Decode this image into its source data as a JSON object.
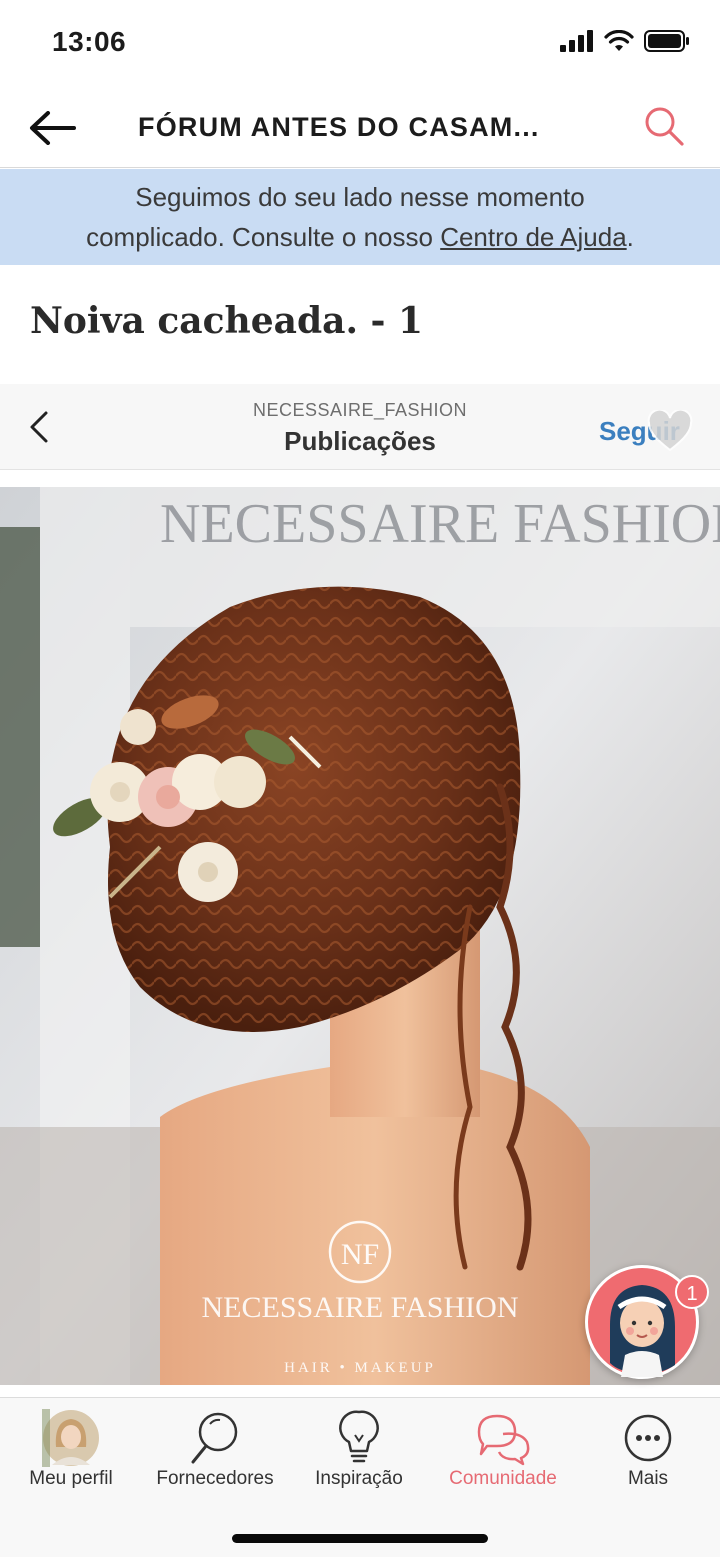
{
  "status_bar": {
    "time": "13:06"
  },
  "header": {
    "title": "FÓRUM ANTES DO CASAM..."
  },
  "banner": {
    "line1": "Seguimos do seu lado nesse momento",
    "line2_prefix": "complicado. Consulte o nosso ",
    "link": "Centro de Ajuda",
    "line2_suffix": "."
  },
  "post": {
    "title": "Noiva cacheada. - 1"
  },
  "embed": {
    "username": "NECESSAIRE_FASHION",
    "section": "Publicações",
    "follow_label": "Seguir"
  },
  "photo": {
    "sign_text": "NECESSAIRE FASHION",
    "logo_initials": "NF",
    "watermark_brand": "NECESSAIRE FASHION",
    "watermark_sub": "HAIR • MAKEUP"
  },
  "chat_badge": {
    "count": "1"
  },
  "tabbar": {
    "items": [
      {
        "label": "Meu perfil",
        "icon": "profile-avatar"
      },
      {
        "label": "Fornecedores",
        "icon": "magnifier-icon"
      },
      {
        "label": "Inspiração",
        "icon": "lightbulb-icon"
      },
      {
        "label": "Comunidade",
        "icon": "chat-bubbles-icon"
      },
      {
        "label": "Mais",
        "icon": "more-icon"
      }
    ],
    "active_color": "#e66a73"
  },
  "colors": {
    "banner_bg": "#c9dcf3",
    "accent": "#e66a73",
    "follow": "#3b7fbf"
  }
}
